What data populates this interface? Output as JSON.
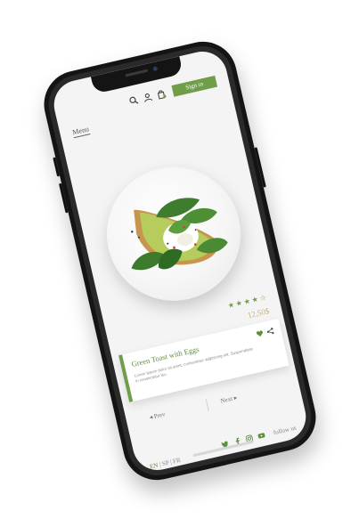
{
  "header": {
    "menu_label": "Menu",
    "signin_label": "Sign in",
    "icons": [
      "search-icon",
      "user-icon",
      "cart-icon"
    ]
  },
  "product": {
    "title": "Green Toast with Eggs",
    "price": "12,50$",
    "rating": 4,
    "rating_max": 5,
    "description": "Lorem ipsum dolor sit amet, consectetur adipiscing elit. Suspendisse in consectetur leo."
  },
  "nav": {
    "prev_label": "Prev",
    "next_label": "Next"
  },
  "footer": {
    "follow_label": "follow us",
    "social_icons": [
      "twitter-icon",
      "facebook-icon",
      "instagram-icon",
      "youtube-icon"
    ],
    "languages": [
      "EN",
      "SP",
      "FR"
    ],
    "active_language": "EN"
  },
  "colors": {
    "accent": "#6f9d4a",
    "price": "#c8b27a",
    "phone_frame": "#141414"
  }
}
